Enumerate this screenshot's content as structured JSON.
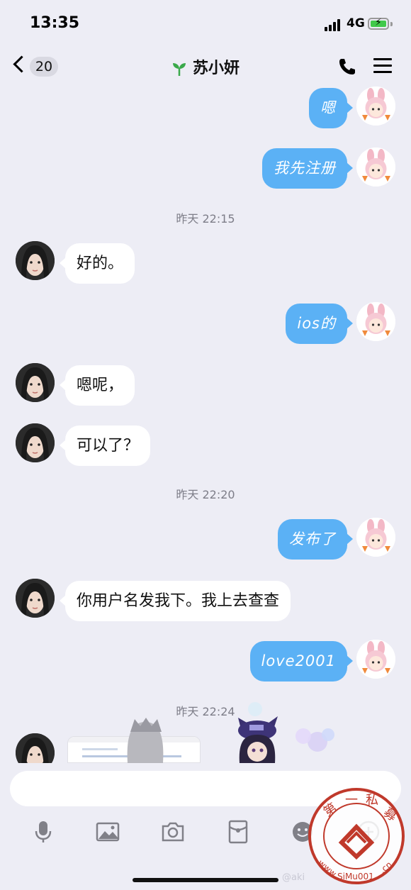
{
  "status": {
    "time": "13:35",
    "network": "4G"
  },
  "nav": {
    "back_count": "20",
    "title": "苏小妍"
  },
  "messages": {
    "m1": "嗯",
    "m2": "我先注册",
    "t1": "昨天 22:15",
    "m3": "好的。",
    "m4": "ios的",
    "m5": "嗯呢，",
    "m6": "可以了？",
    "t2": "昨天 22:20",
    "m7": "发布了",
    "m8": "你用户名发我下。我上去查查",
    "m9": "love2001",
    "t3": "昨天 22:24"
  },
  "icons": {
    "back": "chevron-left-icon",
    "title_badge": "sprout-icon",
    "call": "phone-icon",
    "menu": "menu-icon",
    "toolbar": [
      "microphone-icon",
      "image-icon",
      "camera-icon",
      "red-packet-icon",
      "emoji-icon",
      "more-icon"
    ]
  },
  "watermark": {
    "ring_text": "第一私募",
    "url": "www.SiMu001.cn",
    "overlay": "@aki"
  },
  "colors": {
    "outgoing_bubble": "#5bb1f5",
    "incoming_bubble": "#ffffff",
    "background": "#ededf5",
    "title_badge": "#3aa94a"
  }
}
